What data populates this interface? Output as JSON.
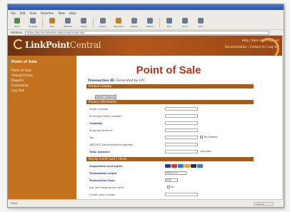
{
  "browser": {
    "menu": [
      "File",
      "Edit",
      "View",
      "Favorites",
      "Tools",
      "Help"
    ],
    "toolbar": [
      "Back",
      "Forward",
      "Stop",
      "Refresh",
      "Home",
      "Search",
      "Favorites",
      "Media",
      "History",
      "Mail",
      "Print",
      "Edit"
    ],
    "address_label": "Address",
    "url": "https://secure.linkpoint.net/lpc/admin/pos.asp",
    "status_text": "Done",
    "status_zone": "Internet"
  },
  "site": {
    "logo_main": "LinkPoint",
    "logo_suffix": "Central",
    "banner_links": [
      "Help | Store Info | Support",
      "Documentation | Contact Us | Log Out"
    ]
  },
  "sidebar": {
    "title": "Point of Sale",
    "items": [
      "Point of Sale",
      "Virtual Check",
      "Reports",
      "Customize",
      "Log Out"
    ]
  },
  "main": {
    "title": "Point of Sale",
    "order_label": "Transaction ID:",
    "order_value": "Generated by LPC",
    "sections": [
      "Product Catalog",
      "Product Information",
      "Pay by Credit Card / Check"
    ],
    "select_button": "Select Products",
    "fields": [
      {
        "label": "Order number",
        "extra": ""
      },
      {
        "label": "Purchase Order number",
        "extra": ""
      },
      {
        "label": "Subtotal",
        "extra": ""
      },
      {
        "label": "Shipping Amount",
        "extra": ""
      },
      {
        "label": "Tax",
        "extra": "Tax Exempt"
      },
      {
        "label": "VAT/GST Amount(where applies)",
        "extra": ""
      },
      {
        "label": "Total Amount",
        "extra": "Calculate"
      }
    ],
    "payment_fields": [
      {
        "label": "Supported card types",
        "extra": ""
      },
      {
        "label": "Transaction origin",
        "extra": "Select one"
      },
      {
        "label": "Transaction type",
        "extra": "Sale"
      },
      {
        "label": "Are you swiping the card?",
        "extra": "No"
      },
      {
        "label": "Credit card number",
        "extra": ""
      }
    ]
  }
}
